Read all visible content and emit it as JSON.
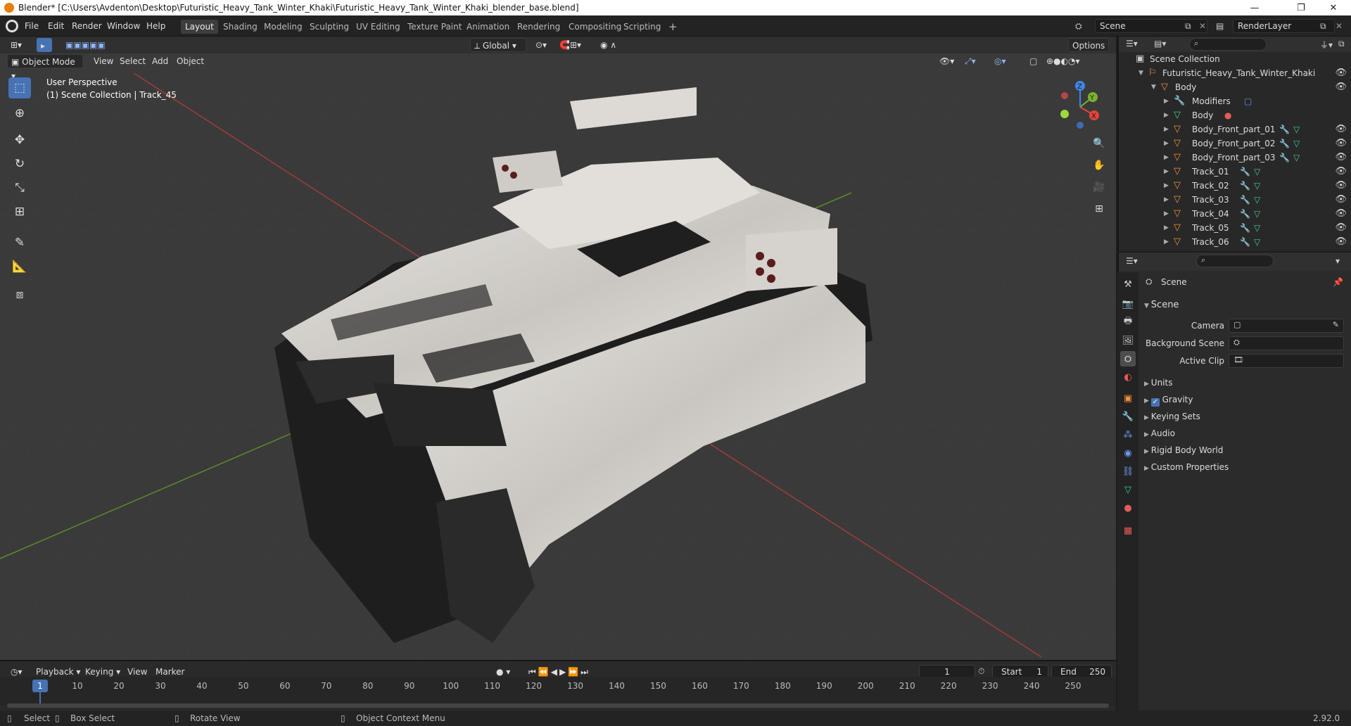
{
  "window": {
    "title": "Blender* [C:\\Users\\Avdenton\\Desktop\\Futuristic_Heavy_Tank_Winter_Khaki\\Futuristic_Heavy_Tank_Winter_Khaki_blender_base.blend]",
    "minimize": "—",
    "maximize": "❐",
    "close": "✕"
  },
  "menu": {
    "items": [
      "File",
      "Edit",
      "Render",
      "Window",
      "Help"
    ]
  },
  "workspaces": {
    "tabs": [
      "Layout",
      "Shading",
      "Modeling",
      "Sculpting",
      "UV Editing",
      "Texture Paint",
      "Animation",
      "Rendering",
      "Compositing",
      "Scripting"
    ],
    "active": "Layout",
    "add": "+"
  },
  "scene_selector": {
    "value": "Scene"
  },
  "view_layer": {
    "value": "RenderLayer"
  },
  "viewport_header": {
    "mode": "Object Mode",
    "menus": [
      "View",
      "Select",
      "Add",
      "Object"
    ],
    "orientation": "Global",
    "options": "Options"
  },
  "viewport": {
    "perspective": "User Perspective",
    "collection_info": "(1) Scene Collection | Track_45",
    "gizmo_axes": {
      "x": "X",
      "y": "Y",
      "z": "Z"
    },
    "colors": {
      "x": "#e7423c",
      "y": "#7cb32c",
      "z": "#3f87e7",
      "background": "#3a3a3a"
    }
  },
  "outliner": {
    "root": "Scene Collection",
    "collection": "Futuristic_Heavy_Tank_Winter_Khaki",
    "items": [
      {
        "label": "Body",
        "type": "object",
        "level": 2,
        "expanded": true
      },
      {
        "label": "Modifiers",
        "type": "modifiers",
        "level": 3
      },
      {
        "label": "Body",
        "type": "mesh",
        "level": 3
      },
      {
        "label": "Body_Front_part_01",
        "type": "object",
        "level": 3
      },
      {
        "label": "Body_Front_part_02",
        "type": "object",
        "level": 3
      },
      {
        "label": "Body_Front_part_03",
        "type": "object",
        "level": 3
      },
      {
        "label": "Track_01",
        "type": "object",
        "level": 3
      },
      {
        "label": "Track_02",
        "type": "object",
        "level": 3
      },
      {
        "label": "Track_03",
        "type": "object",
        "level": 3
      },
      {
        "label": "Track_04",
        "type": "object",
        "level": 3
      },
      {
        "label": "Track_05",
        "type": "object",
        "level": 3
      },
      {
        "label": "Track_06",
        "type": "object",
        "level": 3
      }
    ]
  },
  "properties": {
    "header": "Scene",
    "panel": "Scene",
    "fields": [
      {
        "label": "Camera",
        "value": ""
      },
      {
        "label": "Background Scene",
        "value": ""
      },
      {
        "label": "Active Clip",
        "value": ""
      }
    ],
    "sections": [
      "Units",
      "Gravity",
      "Keying Sets",
      "Audio",
      "Rigid Body World",
      "Custom Properties"
    ],
    "gravity_checked": true
  },
  "timeline": {
    "menus": [
      "Playback",
      "Keying",
      "View",
      "Marker"
    ],
    "current_frame": "1",
    "start_label": "Start",
    "start": "1",
    "end_label": "End",
    "end": "250",
    "ruler": [
      "1",
      "10",
      "20",
      "30",
      "40",
      "50",
      "60",
      "70",
      "80",
      "90",
      "100",
      "110",
      "120",
      "130",
      "140",
      "150",
      "160",
      "170",
      "180",
      "190",
      "200",
      "210",
      "220",
      "230",
      "240",
      "250"
    ]
  },
  "statusbar": {
    "select": "Select",
    "box_select": "Box Select",
    "rotate_view": "Rotate View",
    "context_menu": "Object Context Menu",
    "version": "2.92.0"
  }
}
